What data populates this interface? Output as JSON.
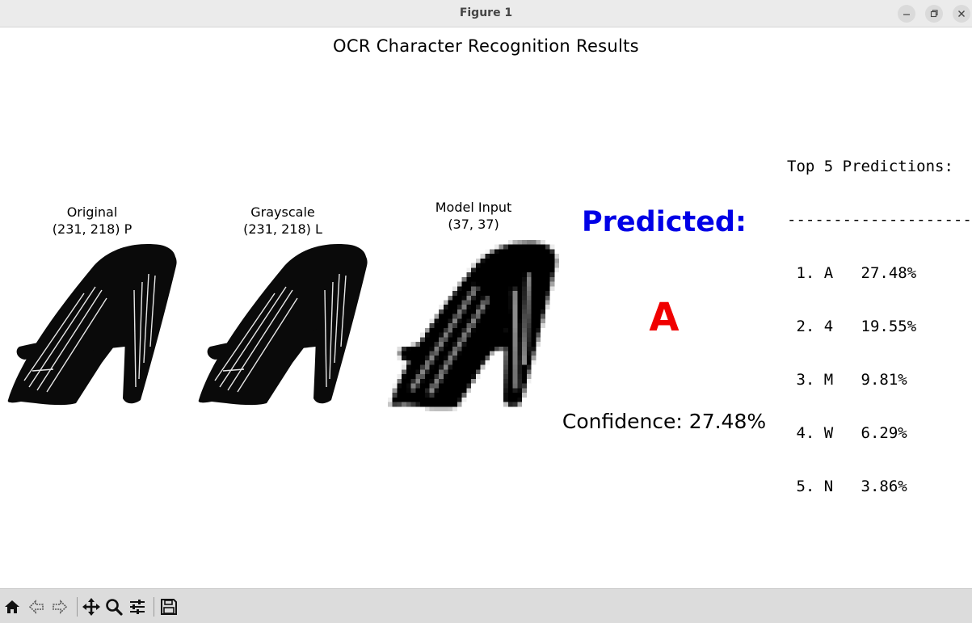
{
  "window": {
    "title": "Figure 1",
    "controls": [
      "minimize-icon",
      "maximize-icon",
      "close-icon"
    ]
  },
  "figure": {
    "title": "OCR Character Recognition Results",
    "panels": [
      {
        "title_line1": "Original",
        "title_line2": "(231, 218) P"
      },
      {
        "title_line1": "Grayscale",
        "title_line2": "(231, 218) L"
      },
      {
        "title_line1": "Model Input",
        "title_line2": "(37, 37)"
      }
    ],
    "predicted_label": "Predicted:",
    "predicted_char": "A",
    "confidence": "Confidence: 27.48%",
    "top5": {
      "header": "Top 5 Predictions:",
      "divider": "--------------------",
      "rows": [
        " 1. A   27.48%",
        " 2. 4   19.55%",
        " 3. M   9.81%",
        " 4. W   6.29%",
        " 5. N   3.86%"
      ]
    },
    "colors": {
      "predicted_label": "#0000e6",
      "predicted_char": "#f00000"
    }
  },
  "toolbar": {
    "buttons": [
      "home-icon",
      "back-icon",
      "forward-icon",
      "pan-icon",
      "zoom-icon",
      "configure-subplots-icon",
      "save-icon"
    ]
  }
}
